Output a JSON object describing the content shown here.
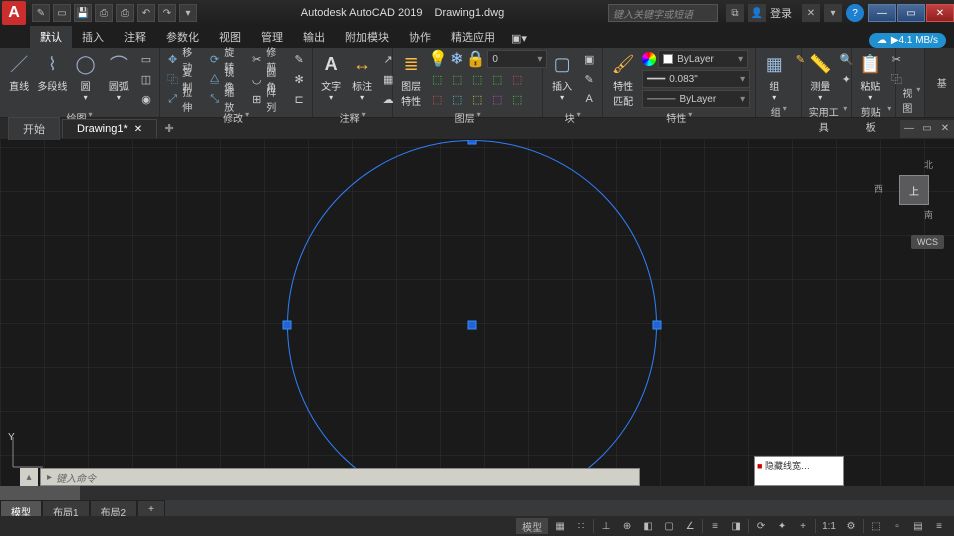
{
  "titlebar": {
    "app_letter": "A",
    "app_title": "Autodesk AutoCAD 2019",
    "doc_title": "Drawing1.dwg",
    "search_placeholder": "键入关键字或短语",
    "login_label": "登录"
  },
  "cloud": {
    "speed": "▶4.1 MB/s"
  },
  "ribbon_tabs": [
    "默认",
    "插入",
    "注释",
    "参数化",
    "视图",
    "管理",
    "输出",
    "附加模块",
    "协作",
    "精选应用"
  ],
  "ribbon_panels": {
    "draw": {
      "title": "绘图",
      "line": "直线",
      "polyline": "多段线",
      "circle": "圆",
      "arc": "圆弧"
    },
    "modify": {
      "title": "修改",
      "move": "移动",
      "rotate": "旋转",
      "trim": "修剪",
      "copy": "复制",
      "mirror": "镜像",
      "fillet": "圆角",
      "stretch": "拉伸",
      "scale": "缩放",
      "array": "阵列"
    },
    "annotate": {
      "title": "注释",
      "text": "文字",
      "dim": "标注"
    },
    "layer": {
      "title": "图层",
      "props": "图层\n特性"
    },
    "block": {
      "title": "块",
      "insert": "插入"
    },
    "props": {
      "title": "特性",
      "match": "特性\n匹配",
      "layer_value": "ByLayer",
      "lw_value": "0.083\"",
      "lt_value": "ByLayer"
    },
    "group": {
      "title": "组",
      "group": "组"
    },
    "util": {
      "title": "实用工具",
      "measure": "测量"
    },
    "clip": {
      "title": "剪贴板",
      "paste": "粘贴"
    },
    "view": {
      "title": "视图"
    },
    "basic": {
      "title": "基"
    }
  },
  "doc_tabs": {
    "start": "开始",
    "drawing": "Drawing1*"
  },
  "navcube": {
    "top": "上",
    "n": "北",
    "w": "西",
    "s": "南"
  },
  "wcs": "WCS",
  "ucs": {
    "y": "Y"
  },
  "cmd": {
    "placeholder": "键入命令"
  },
  "layout_tabs": [
    "模型",
    "布局1",
    "布局2"
  ],
  "popup_text": "隐藏线宽…",
  "status": {
    "model": "模型",
    "scale": "1:1"
  }
}
